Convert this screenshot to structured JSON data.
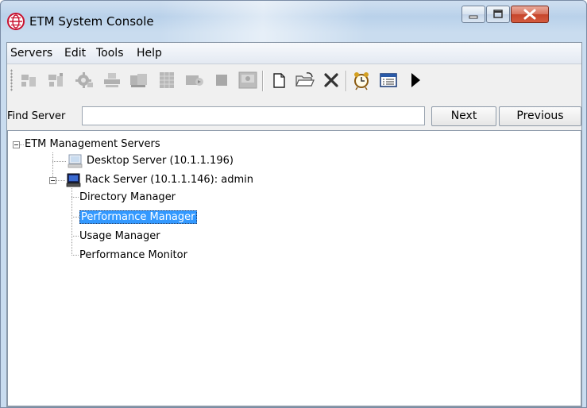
{
  "window": {
    "title": "ETM System Console",
    "controls": {
      "minimize": "minimize-icon",
      "maximize": "maximize-icon",
      "close": "close-icon"
    }
  },
  "menubar": {
    "items": [
      "Servers",
      "Edit",
      "Tools",
      "Help"
    ]
  },
  "toolbar": {
    "buttons": [
      "connect-icon",
      "disconnect-icon",
      "settings-gear-icon",
      "print-icon",
      "server-icon",
      "grid-icon",
      "forward-server-icon",
      "stop-icon",
      "image-icon",
      "new-document-icon",
      "open-folder-icon",
      "delete-x-icon",
      "alarm-clock-icon",
      "window-list-icon",
      "play-arrow-icon"
    ]
  },
  "find": {
    "label": "Find Server",
    "value": "",
    "next_label": "Next",
    "previous_label": "Previous"
  },
  "tree": {
    "root": "ETM Management Servers",
    "servers": [
      {
        "label": "Desktop Server (10.1.1.196)",
        "icon": "desktop-computer-icon"
      },
      {
        "label": "Rack Server (10.1.1.146): admin",
        "icon": "rack-computer-icon",
        "children": [
          "Directory Manager",
          "Performance Manager",
          "Usage Manager",
          "Performance Monitor"
        ],
        "selected_child": "Performance Manager"
      }
    ]
  },
  "colors": {
    "selection": "#3399ff",
    "title_bar": "#b9d1ea",
    "close_button": "#c6452b"
  }
}
